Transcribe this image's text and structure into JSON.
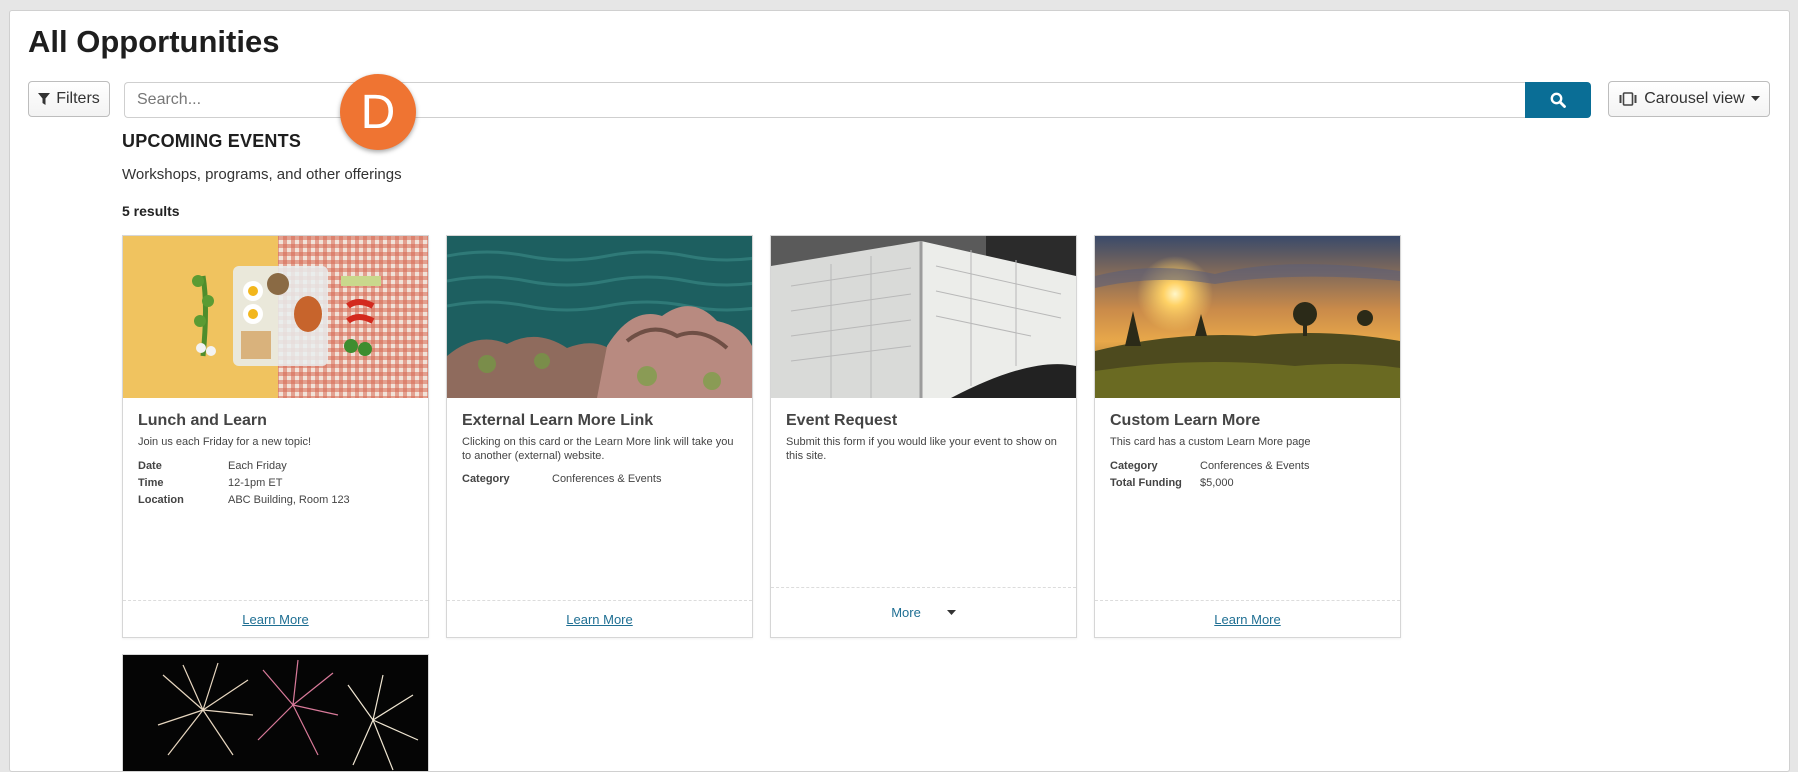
{
  "page": {
    "title": "All Opportunities"
  },
  "toolbar": {
    "filters_label": "Filters",
    "search_placeholder": "Search...",
    "view_label": "Carousel view",
    "badge_letter": "D",
    "badge_color": "#ef7432",
    "search_button_color": "#0a6e96"
  },
  "section": {
    "title": "UPCOMING EVENTS",
    "subtitle": "Workshops, programs, and other offerings",
    "results": "5 results"
  },
  "cards": [
    {
      "title": "Lunch and Learn",
      "description": "Join us each Friday for a new topic!",
      "meta": [
        {
          "label": "Date",
          "value": "Each Friday"
        },
        {
          "label": "Time",
          "value": "12-1pm ET"
        },
        {
          "label": "Location",
          "value": "ABC Building, Room 123"
        }
      ],
      "action": "Learn More"
    },
    {
      "title": "External Learn More Link",
      "description": "Clicking on this card or the Learn More link will take you to another (external) website.",
      "meta": [
        {
          "label": "Category",
          "value": "Conferences & Events"
        }
      ],
      "action": "Learn More"
    },
    {
      "title": "Event Request",
      "description": "Submit this form if you would like your event to show on this site.",
      "meta": [],
      "action": "More"
    },
    {
      "title": "Custom Learn More",
      "description": "This card has a custom Learn More page",
      "meta": [
        {
          "label": "Category",
          "value": "Conferences & Events"
        },
        {
          "label": "Total Funding",
          "value": "$5,000"
        }
      ],
      "action": "Learn More"
    }
  ],
  "icons": {
    "filter": "filter-icon",
    "search": "search-icon",
    "carousel": "carousel-icon",
    "caret": "caret-down-icon"
  }
}
